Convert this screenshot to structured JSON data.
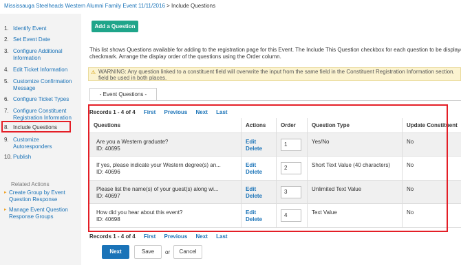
{
  "breadcrumb": {
    "event_link": "Mississauga Steelheads Western Alumni Family Event 11/11/2016",
    "separator": " > ",
    "current": "Include Questions"
  },
  "sidebar": {
    "steps": [
      {
        "num": "1.",
        "label": "Identify Event"
      },
      {
        "num": "2.",
        "label": "Set Event Date"
      },
      {
        "num": "3.",
        "label": "Configure Additional Information"
      },
      {
        "num": "4.",
        "label": "Edit Ticket Information"
      },
      {
        "num": "5.",
        "label": "Customize Confirmation Message"
      },
      {
        "num": "6.",
        "label": "Configure Ticket Types"
      },
      {
        "num": "7.",
        "label": "Configure Constituent Registration Information"
      },
      {
        "num": "8.",
        "label": "Include Questions"
      },
      {
        "num": "9.",
        "label": "Customize Autoresponders"
      },
      {
        "num": "10.",
        "label": "Publish"
      }
    ],
    "related_title": "Related Actions",
    "related": [
      "Create Group by Event Question Response",
      "Manage Event Question Response Groups"
    ]
  },
  "main": {
    "add_button": "Add a Question",
    "description": "This list shows Questions available for adding to the registration page for this Event. The Include This Question checkbox for each question to be displayed on the registration page, and clear the checkmark. Arrange the display order of the questions using the Order column.",
    "description_line1": "This list shows Questions available for adding to the registration page for this Event. The Include This Question checkbox for each question to be displaye",
    "description_line2": "checkmark. Arrange the display order of the questions using the Order column.",
    "warning_line1": "WARNING: Any question linked to a constituent field will overwrite the input from the same field in the Constituent Registration Information section.",
    "warning_line2": "field be used in both places.",
    "tab": "- Event Questions -",
    "pager": {
      "count": "Records 1 - 4 of 4",
      "first": "First",
      "previous": "Previous",
      "next": "Next",
      "last": "Last"
    },
    "columns": [
      "Questions",
      "Actions",
      "Order",
      "Question Type",
      "Update Constituent"
    ],
    "rows": [
      {
        "question": "Are you a Western graduate?",
        "id": "ID: 40695",
        "edit": "Edit",
        "delete": "Delete",
        "order": "1",
        "type": "Yes/No",
        "update": "No"
      },
      {
        "question": "If yes, please indicate your Western degree(s) an...",
        "id": "ID: 40696",
        "edit": "Edit",
        "delete": "Delete",
        "order": "2",
        "type": "Short Text Value (40 characters)",
        "update": "No"
      },
      {
        "question": "Please list the name(s) of your guest(s) along wi...",
        "id": "ID: 40697",
        "edit": "Edit",
        "delete": "Delete",
        "order": "3",
        "type": "Unlimited Text Value",
        "update": "No"
      },
      {
        "question": "How did you hear about this event?",
        "id": "ID: 40698",
        "edit": "Edit",
        "delete": "Delete",
        "order": "4",
        "type": "Text Value",
        "update": "No"
      }
    ],
    "buttons": {
      "next": "Next",
      "save": "Save",
      "or": "or",
      "cancel": "Cancel"
    }
  },
  "colors": {
    "accent_teal": "#1fa58a",
    "link_blue": "#1a73b8",
    "highlight_red": "#e41e26",
    "warning_bg": "#fbf3d0"
  }
}
